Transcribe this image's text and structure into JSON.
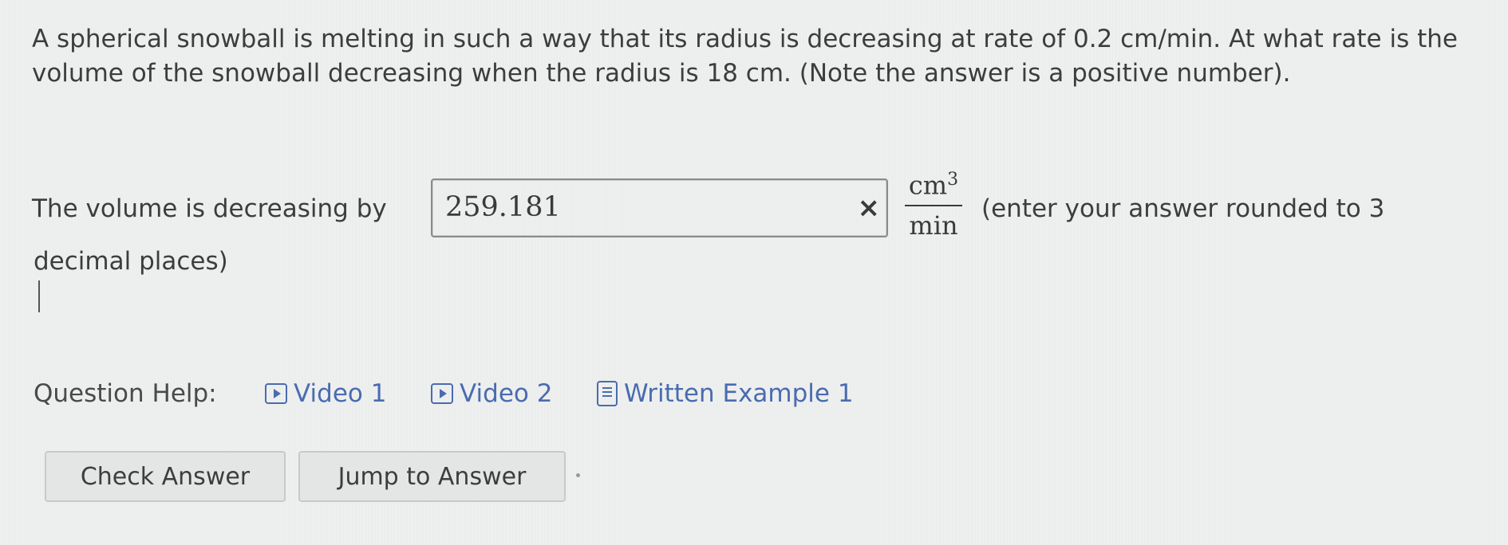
{
  "question": {
    "text": "A spherical snowball is melting in such a way that its radius is decreasing at rate of 0.2 cm/min. At what rate is the volume of the snowball decreasing when the radius is 18 cm. (Note the answer is a positive number)."
  },
  "answer": {
    "prefix": "The volume is decreasing by",
    "value": "259.181",
    "status_mark": "×",
    "unit_numerator": "cm",
    "unit_exponent": "3",
    "unit_denominator": "min",
    "suffix": "(enter your answer rounded to 3",
    "continuation": "decimal places)"
  },
  "help": {
    "label": "Question Help:",
    "links": [
      {
        "label": "Video 1",
        "icon": "play-video-icon"
      },
      {
        "label": "Video 2",
        "icon": "play-video-icon"
      },
      {
        "label": "Written Example 1",
        "icon": "document-icon"
      }
    ]
  },
  "buttons": {
    "check": "Check Answer",
    "jump": "Jump to Answer"
  },
  "colors": {
    "link": "#4b6bb0",
    "text": "#3d3d3d",
    "background": "#eceeed"
  }
}
